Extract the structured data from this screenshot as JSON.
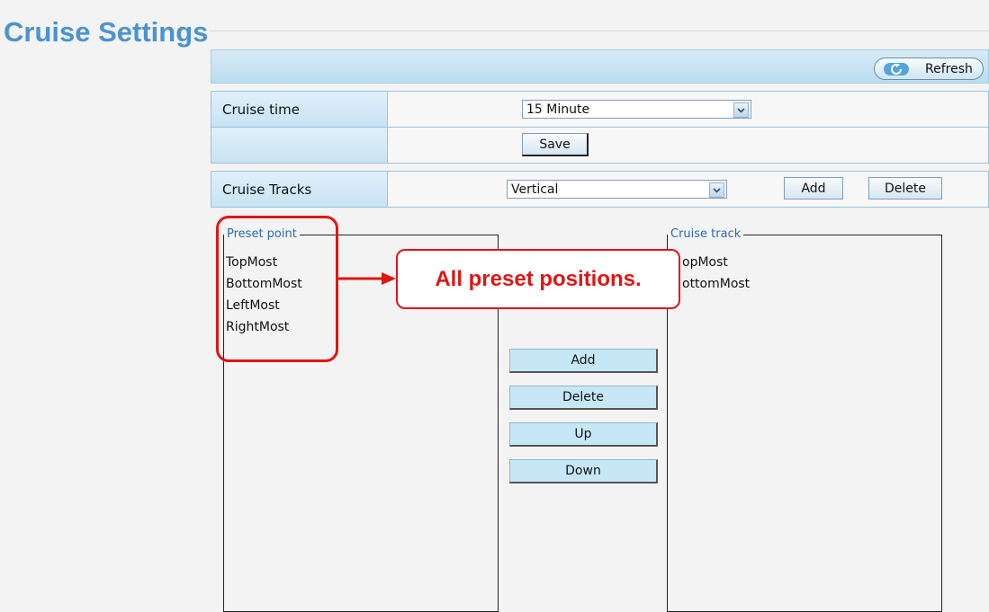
{
  "page": {
    "title": "Cruise Settings"
  },
  "toolbar": {
    "refresh_label": "Refresh",
    "refresh_icon": "refresh-icon"
  },
  "cruise_time": {
    "label": "Cruise time",
    "selected": "15 Minute",
    "save_label": "Save"
  },
  "cruise_tracks": {
    "label": "Cruise Tracks",
    "selected": "Vertical",
    "add_label": "Add",
    "delete_label": "Delete"
  },
  "preset_panel": {
    "legend": "Preset point",
    "items": [
      "TopMost",
      "BottomMost",
      "LeftMost",
      "RightMost"
    ]
  },
  "track_panel": {
    "legend": "Cruise track",
    "items": [
      "opMost",
      "ottomMost"
    ]
  },
  "actions": {
    "add": "Add",
    "delete": "Delete",
    "up": "Up",
    "down": "Down"
  },
  "annotation": {
    "text": "All preset positions.",
    "color": "#e01515"
  },
  "colors": {
    "title": "#4b93cf",
    "header_bar": "#c4e1f2",
    "button_fill": "#c6e8f6",
    "legend": "#2b69b3"
  }
}
